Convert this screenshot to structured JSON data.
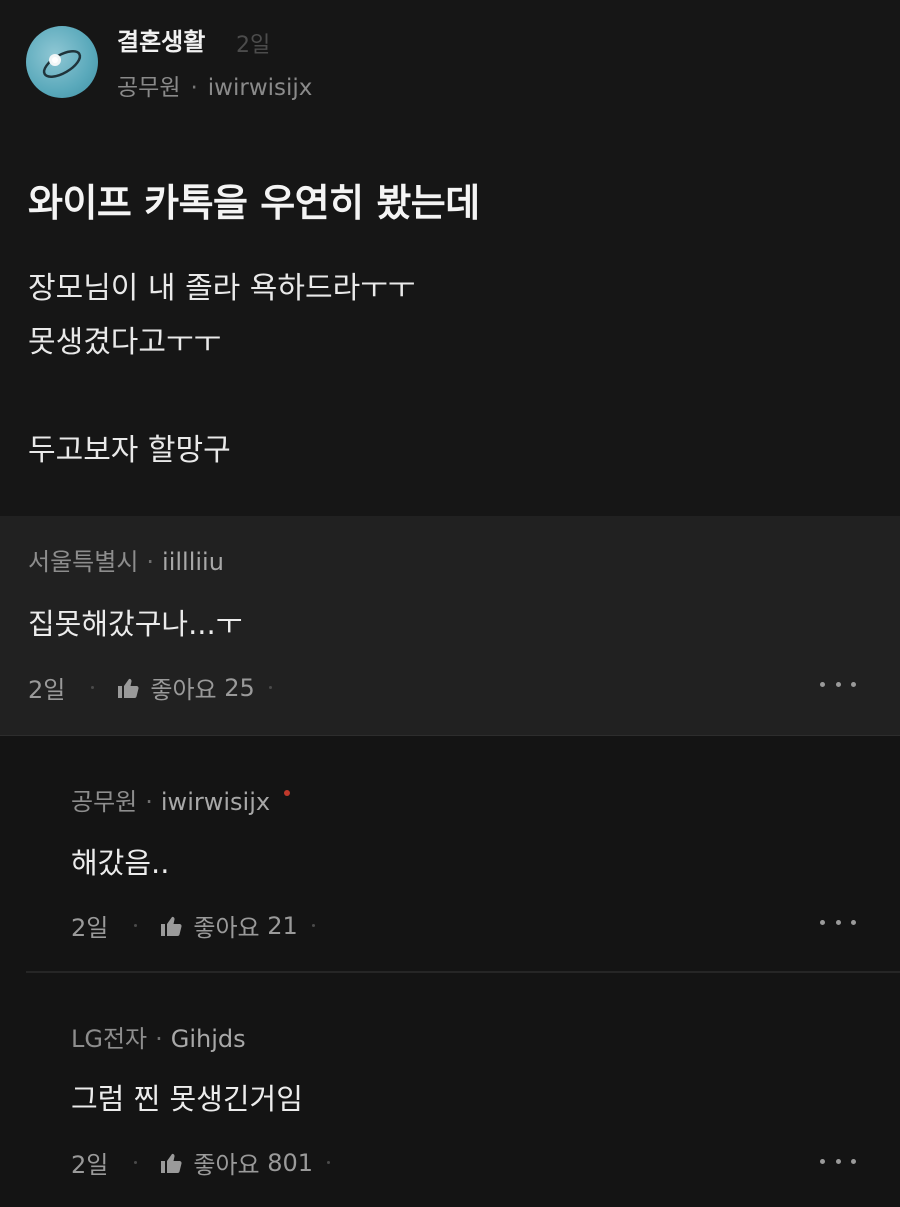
{
  "post": {
    "board_name": "결혼생활",
    "time": "2일",
    "author_company": "공무원",
    "author_nick": "iwirwisijx",
    "title": "와이프 카톡을 우연히 봤는데",
    "body_lines": [
      "장모님이 내 졸라 욕하드라ㅜㅜ",
      "못생겼다고ㅜㅜ",
      "",
      "두고보자 할망구"
    ]
  },
  "comments": [
    {
      "company": "서울특별시",
      "nick": "iillliiu",
      "text": "집못해갔구나...ㅜ",
      "time": "2일",
      "like_label": "좋아요",
      "likes": "25"
    },
    {
      "company": "공무원",
      "nick": "iwirwisijx",
      "text": "해갔음..",
      "time": "2일",
      "like_label": "좋아요",
      "likes": "21"
    },
    {
      "company": "LG전자",
      "nick": "Gihjds",
      "text": "그럼 찐 못생긴거임",
      "time": "2일",
      "like_label": "좋아요",
      "likes": "801"
    }
  ],
  "icons": {
    "like": "thumbs-up-icon",
    "more": "more-horizontal-icon",
    "op_marker": "red-dot"
  },
  "colors": {
    "background": "#141414",
    "comment_highlight": "#212121",
    "op_marker": "#c0392b"
  }
}
